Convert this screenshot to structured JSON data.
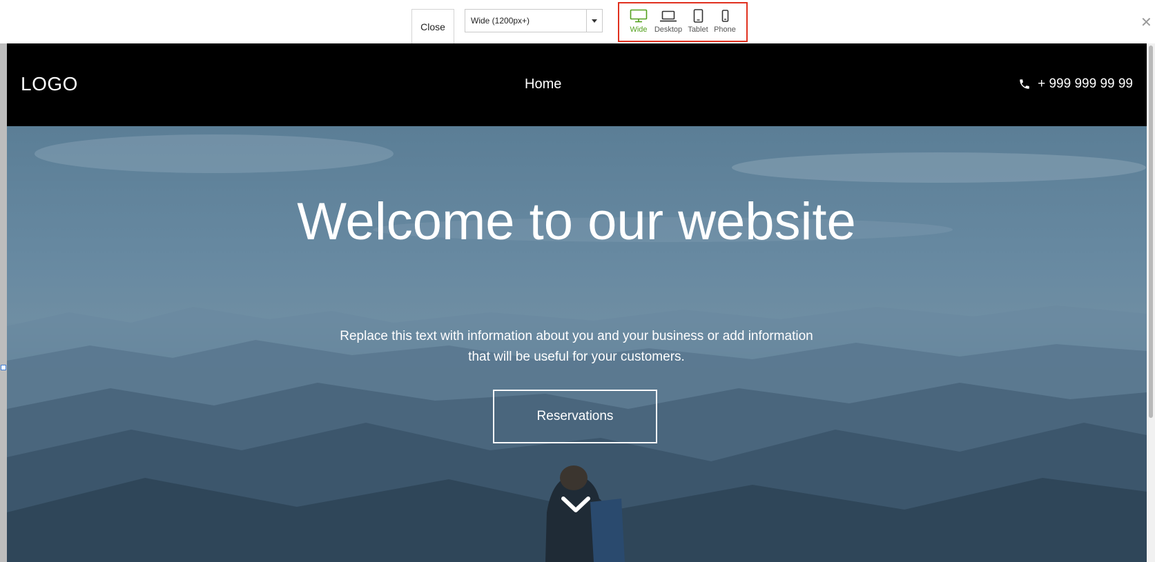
{
  "toolbar": {
    "close_label": "Close",
    "viewport_select": {
      "selected": "Wide (1200px+)"
    },
    "devices": [
      {
        "label": "Wide",
        "icon": "monitor-icon",
        "active": true
      },
      {
        "label": "Desktop",
        "icon": "laptop-icon",
        "active": false
      },
      {
        "label": "Tablet",
        "icon": "tablet-icon",
        "active": false
      },
      {
        "label": "Phone",
        "icon": "phone-icon",
        "active": false
      }
    ],
    "dismiss_icon": "close-icon",
    "highlight_color": "#e0301e",
    "active_color": "#52a01c"
  },
  "site": {
    "logo": "LOGO",
    "nav": {
      "home": "Home"
    },
    "phone": {
      "icon": "telephone-icon",
      "number": "+ 999 999 99 99"
    },
    "hero": {
      "title": "Welcome to our website",
      "text": "Replace this text with information about you and your business or add information that will be useful for your customers.",
      "button_label": "Reservations",
      "scroll_icon": "chevron-down-icon"
    }
  }
}
